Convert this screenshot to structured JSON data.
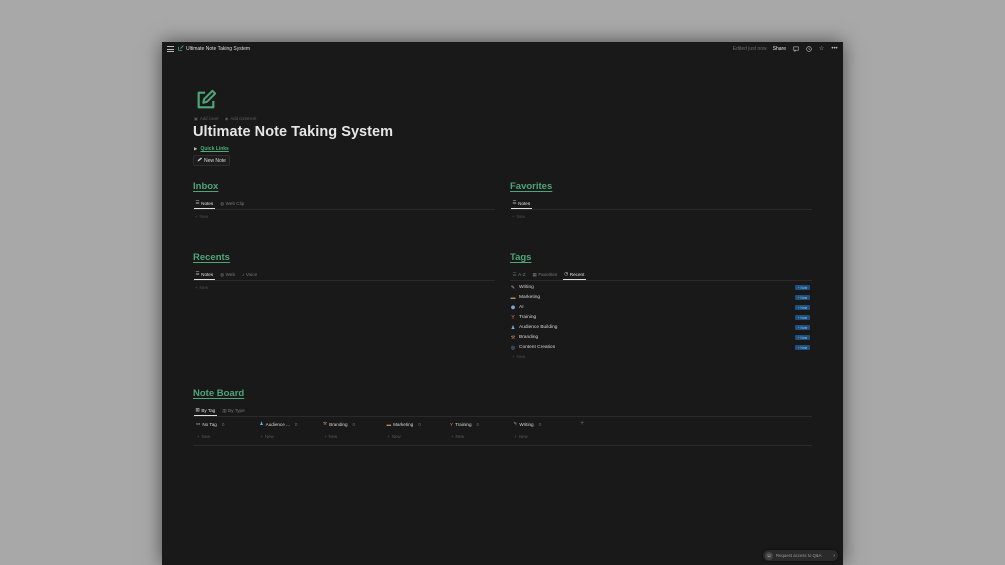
{
  "topbar": {
    "title": "Ultimate Note Taking System",
    "edited": "Edited just now",
    "share": "Share"
  },
  "page": {
    "title": "Ultimate Note Taking System",
    "add_cover": "Add cover",
    "add_comment": "Add comment",
    "quick_links": "Quick Links",
    "new_note": "New Note"
  },
  "inbox": {
    "title": "Inbox",
    "tabs": [
      "Notes",
      "Web Clip"
    ],
    "new": "New"
  },
  "favorites": {
    "title": "Favorites",
    "tabs": [
      "Notes"
    ],
    "new": "New"
  },
  "recents": {
    "title": "Recents",
    "tabs": [
      "Notes",
      "Web",
      "Voice"
    ],
    "new": "New"
  },
  "tags": {
    "title": "Tags",
    "tabs": [
      "A-Z",
      "Favorites",
      "Recent"
    ],
    "new": "New",
    "items": [
      {
        "label": "Writing",
        "icon": "pencil-icon",
        "badge": "+ Note"
      },
      {
        "label": "Marketing",
        "icon": "folder-icon",
        "badge": "+ Note"
      },
      {
        "label": "AI",
        "icon": "cube-icon",
        "badge": "+ Note"
      },
      {
        "label": "Training",
        "icon": "training-icon",
        "badge": "+ Note"
      },
      {
        "label": "Audience Building",
        "icon": "person-icon",
        "badge": "+ Note"
      },
      {
        "label": "Branding",
        "icon": "tools-icon",
        "badge": "+ Note"
      },
      {
        "label": "Content Creation",
        "icon": "globe-icon",
        "badge": "+ Note"
      }
    ]
  },
  "board": {
    "title": "Note Board",
    "tabs": [
      "By Tag",
      "By Type"
    ],
    "columns": [
      {
        "label": "No Tag",
        "count": "0",
        "icon": "inbox-icon"
      },
      {
        "label": "Audience ...",
        "count": "0",
        "icon": "person-icon"
      },
      {
        "label": "Branding",
        "count": "0",
        "icon": "tools-icon"
      },
      {
        "label": "Marketing",
        "count": "0",
        "icon": "folder-icon"
      },
      {
        "label": "Training",
        "count": "0",
        "icon": "training-icon"
      },
      {
        "label": "Writing",
        "count": "0",
        "icon": "pencil-icon"
      }
    ],
    "new": "New"
  },
  "request_access": "Request access to Q&A",
  "colors": {
    "accent": "#4ea57a",
    "background": "#191919",
    "badge": "#1f4f7a"
  }
}
